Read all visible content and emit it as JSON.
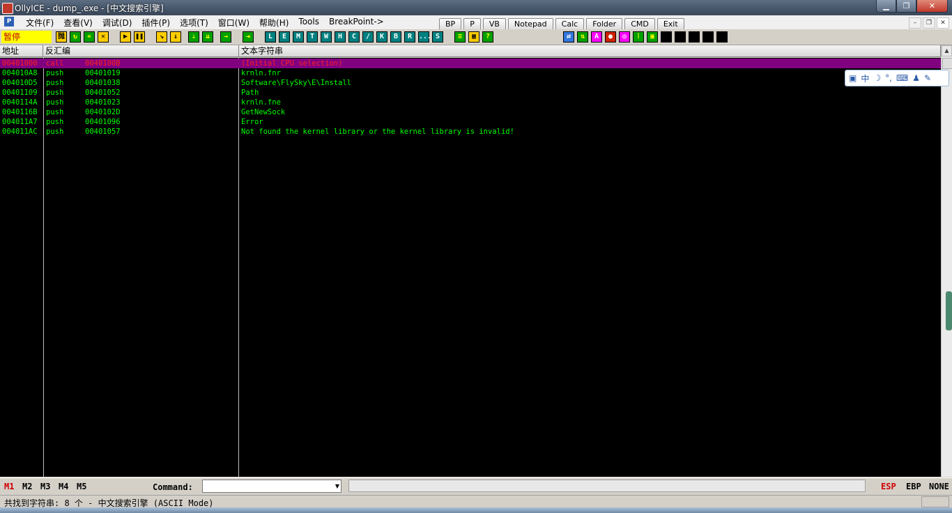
{
  "window": {
    "title": "OllyICE - dump_.exe - [中文搜索引擎]"
  },
  "menu": {
    "items": [
      "文件(F)",
      "查看(V)",
      "调试(D)",
      "插件(P)",
      "选项(T)",
      "窗口(W)",
      "帮助(H)",
      "Tools",
      "BreakPoint->"
    ],
    "plugin_buttons": [
      "BP",
      "P",
      "VB",
      "Notepad",
      "Calc",
      "Folder",
      "CMD",
      "Exit"
    ]
  },
  "toolbar": {
    "status": "暂停",
    "letter_buttons": [
      "L",
      "E",
      "M",
      "T",
      "W",
      "H",
      "C",
      "/",
      "K",
      "B",
      "R",
      "...",
      "S"
    ]
  },
  "columns": [
    "地址",
    "反汇编",
    "文本字符串"
  ],
  "rows": [
    {
      "addr": "00401000",
      "op": "call",
      "arg": "0040100B",
      "text": "(Initial CPU selection)",
      "selected": true
    },
    {
      "addr": "004010A8",
      "op": "push",
      "arg": "00401019",
      "text": "krnln.fnr",
      "selected": false
    },
    {
      "addr": "004010D5",
      "op": "push",
      "arg": "00401038",
      "text": "Software\\FlySky\\E\\Install",
      "selected": false
    },
    {
      "addr": "00401109",
      "op": "push",
      "arg": "00401052",
      "text": "Path",
      "selected": false
    },
    {
      "addr": "0040114A",
      "op": "push",
      "arg": "00401023",
      "text": "krnln.fne",
      "selected": false
    },
    {
      "addr": "0040116B",
      "op": "push",
      "arg": "0040102D",
      "text": "GetNewSock",
      "selected": false
    },
    {
      "addr": "004011A7",
      "op": "push",
      "arg": "00401096",
      "text": "Error",
      "selected": false
    },
    {
      "addr": "004011AC",
      "op": "push",
      "arg": "00401057",
      "text": "Not found the kernel library or the kernel library is invalid!",
      "selected": false
    }
  ],
  "command_bar": {
    "mem_tabs": [
      "M1",
      "M2",
      "M3",
      "M4",
      "M5"
    ],
    "label": "Command:",
    "input_value": "",
    "registers": [
      "ESP",
      "EBP",
      "NONE"
    ]
  },
  "ime": {
    "label": "中"
  },
  "status": {
    "text": "共找到字符串: 8 个  -  中文搜索引擎 (ASCII Mode)"
  },
  "colors": {
    "selected_row_bg": "#800080",
    "text_green": "#00ff00",
    "pause_bg": "#ffff00"
  }
}
